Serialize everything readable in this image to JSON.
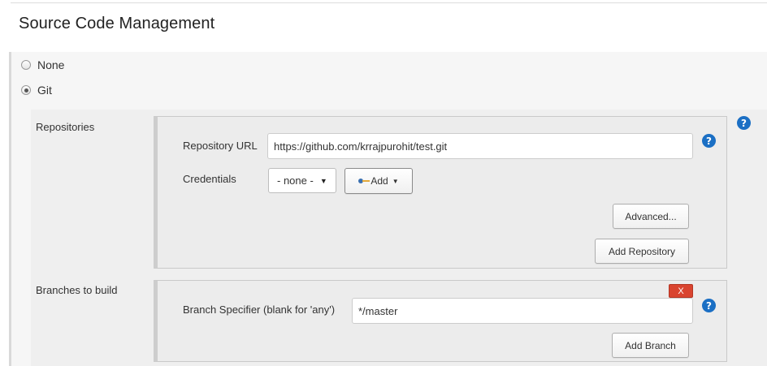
{
  "section": {
    "title": "Source Code Management"
  },
  "scm_options": [
    {
      "label": "None",
      "checked": false
    },
    {
      "label": "Git",
      "checked": true
    }
  ],
  "repositories": {
    "label": "Repositories",
    "url_label": "Repository URL",
    "url_value": "https://github.com/krrajpurohit/test.git",
    "credentials_label": "Credentials",
    "credentials_selected": "- none -",
    "add_label": "Add",
    "advanced_label": "Advanced...",
    "add_repository_label": "Add Repository"
  },
  "branches": {
    "label": "Branches to build",
    "specifier_label": "Branch Specifier (blank for 'any')",
    "specifier_value": "*/master",
    "delete_label": "X",
    "add_branch_label": "Add Branch"
  },
  "help_icon": "?",
  "colors": {
    "help": "#1b6fc4",
    "delete": "#d9442f"
  }
}
